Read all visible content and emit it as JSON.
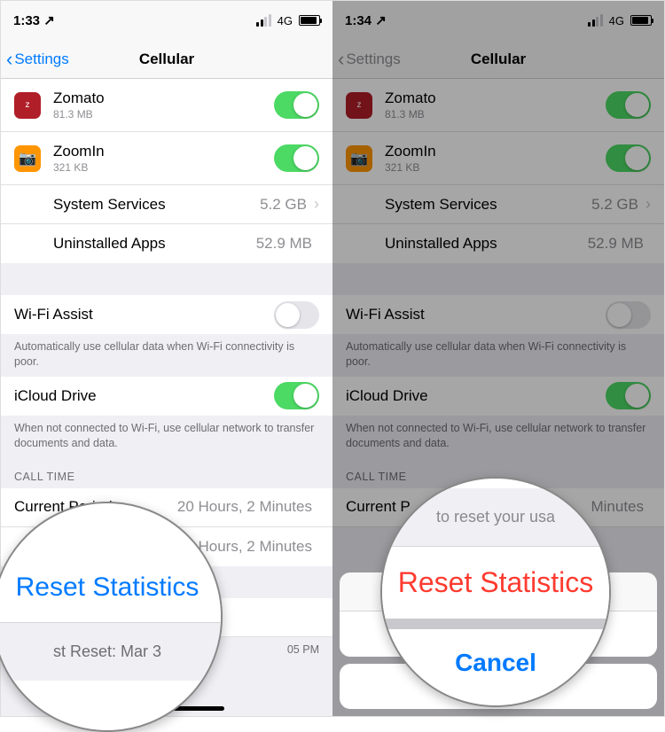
{
  "status": {
    "time_left": "1:33 ↗",
    "time_right": "1:34 ↗",
    "network": "4G"
  },
  "nav": {
    "back": "Settings",
    "title": "Cellular"
  },
  "apps": [
    {
      "name": "Zomato",
      "size": "81.3 MB",
      "bg": "#b01e28",
      "glyph": "zomato"
    },
    {
      "name": "ZoomIn",
      "size": "321 KB",
      "bg": "#ff9500",
      "glyph": "📷"
    }
  ],
  "rows": {
    "system_services": {
      "label": "System Services",
      "value": "5.2 GB"
    },
    "uninstalled": {
      "label": "Uninstalled Apps",
      "value": "52.9 MB"
    },
    "wifi_assist": {
      "label": "Wi-Fi Assist"
    },
    "icloud_drive": {
      "label": "iCloud Drive"
    },
    "current_period": {
      "label": "Current Period",
      "value": "20 Hours, 2 Minutes"
    },
    "lifetime": {
      "label": "",
      "value": "20 Hours, 2 Minutes"
    }
  },
  "notes": {
    "wifi_assist": "Automatically use cellular data when Wi-Fi connectivity is poor.",
    "icloud": "When not connected to Wi-Fi, use cellular network to transfer documents and data.",
    "call_time": "CALL TIME"
  },
  "reset": {
    "label": "Reset Statistics",
    "last": "st Reset: Mar 3",
    "last_suffix": "05 PM"
  },
  "sheet": {
    "msg": "to reset your usa",
    "reset": "Reset Statistics",
    "cancel": "Cancel"
  },
  "mag": {
    "reset": "Reset Statistics",
    "cancelmag": "Cancel"
  }
}
